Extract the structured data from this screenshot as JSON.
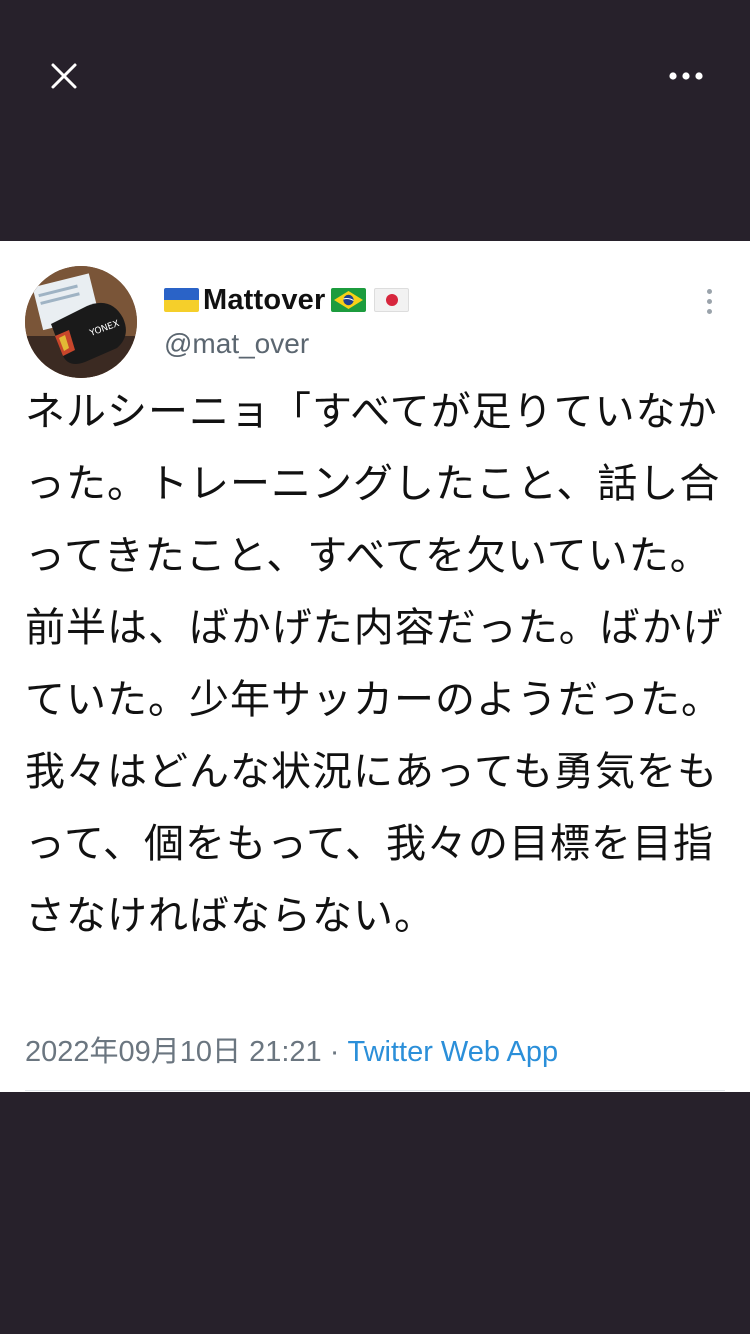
{
  "topbar": {
    "close_icon": "close-icon",
    "more_icon": "more-horizontal-icon"
  },
  "tweet": {
    "display_name": "Mattover",
    "name_flags": [
      "ukraine-flag",
      "brazil-flag",
      "japan-flag"
    ],
    "handle": "@mat_over",
    "text": "ネルシーニョ「すべてが足りていなかった。トレーニングしたこと、話し合ってきたこと、すべてを欠いていた。前半は、ばかげた内容だった。ばかげていた。少年サッカーのようだった。我々はどんな状況にあっても勇気をもって、個をもって、我々の目標を目指さなければならない。",
    "timestamp": "2022年09月10日 21:21",
    "separator": "·",
    "source": "Twitter Web App"
  },
  "colors": {
    "backdrop": "#27212b",
    "card": "#ffffff",
    "text": "#111111",
    "secondary": "#5b6670",
    "link": "#2b8fd9"
  }
}
